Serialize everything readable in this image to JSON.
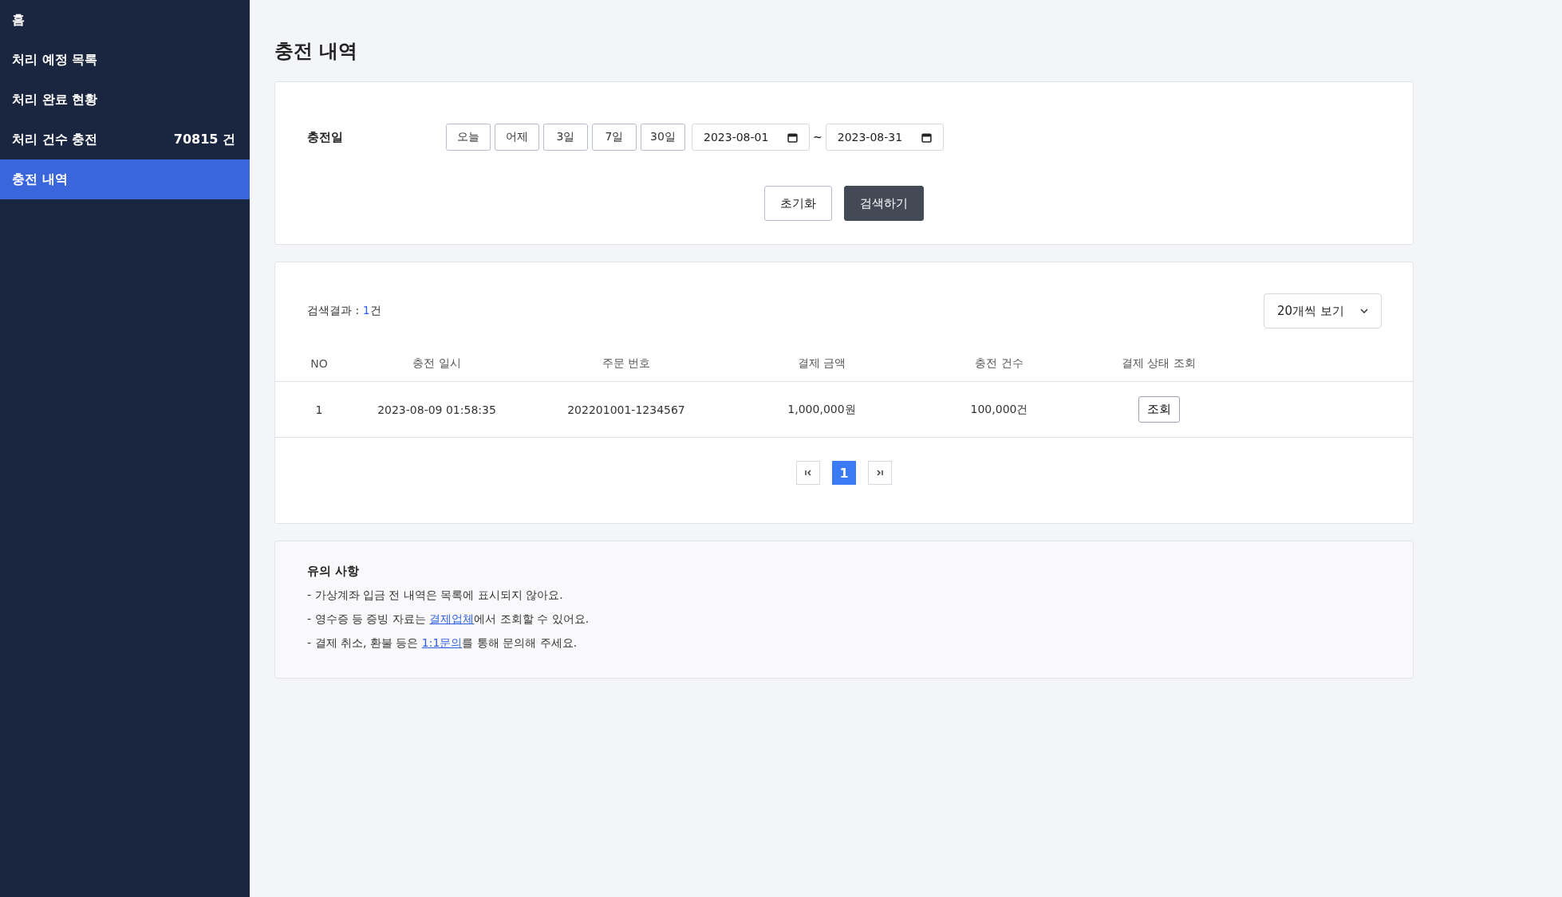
{
  "sidebar": {
    "items": [
      {
        "label": "홈",
        "selected": false
      },
      {
        "label": "처리 예정 목록",
        "selected": false
      },
      {
        "label": "처리 완료 현황",
        "selected": false
      },
      {
        "label": "처리 건수 충전",
        "count": "70815 건",
        "selected": false
      },
      {
        "label": "충전 내역",
        "selected": true
      }
    ]
  },
  "page_title": "충전 내역",
  "filter": {
    "label": "충전일",
    "quick_ranges": [
      {
        "label": "오늘",
        "selected": false
      },
      {
        "label": "어제",
        "selected": false
      },
      {
        "label": "3일",
        "selected": false
      },
      {
        "label": "7일",
        "selected": false
      },
      {
        "label": "30일",
        "selected": false
      }
    ],
    "start_date": "2023-08-01",
    "separator": "~",
    "end_date": "2023-08-31",
    "buttons": [
      {
        "label": "초기화",
        "kind": "secondary"
      },
      {
        "label": "검색하기",
        "kind": "primary"
      }
    ]
  },
  "results": {
    "summary_prefix": "검색결과 : ",
    "summary_count": "1",
    "summary_suffix": "건",
    "page_size": "20개씩 보기",
    "table": {
      "columns": [
        "NO",
        "충전 일시",
        "주문 번호",
        "결제 금액",
        "충전 건수",
        "결제 상태 조회"
      ],
      "rows": [
        {
          "cells": [
            "1",
            "2023-08-09 01:58:35",
            "202201001-1234567",
            "1,000,000원",
            "100,000건"
          ],
          "action": "조회"
        }
      ]
    },
    "pages": [
      {
        "label": "1",
        "selected": true
      }
    ]
  },
  "notes": {
    "title": "유의 사항",
    "lines": [
      {
        "before": "- 가상계좌 입금 전 내역은 목록에 표시되지 않아요."
      },
      {
        "before": "- 영수증 등 증빙 자료는 ",
        "link": "결제업체",
        "after": "에서 조회할 수 있어요."
      },
      {
        "before": "- 결제 취소, 환불 등은 ",
        "link": "1:1문의",
        "after": "를 통해 문의해 주세요."
      }
    ]
  }
}
